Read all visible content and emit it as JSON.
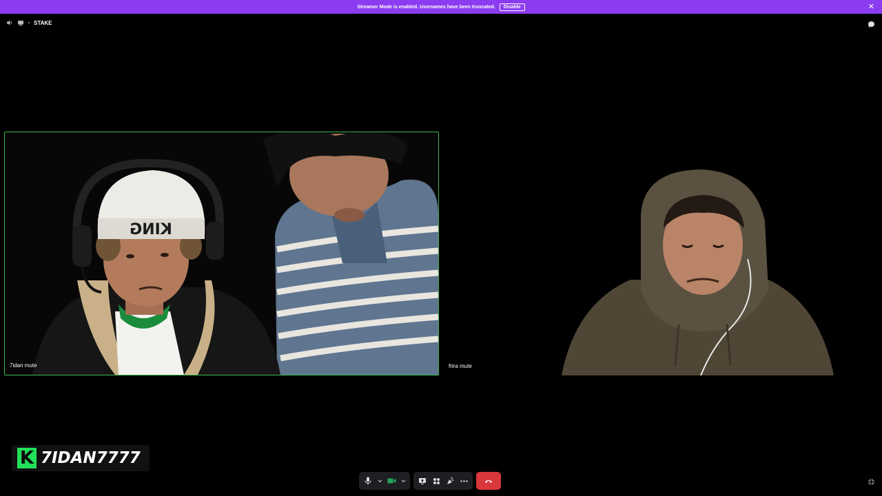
{
  "banner": {
    "text": "Streamer Mode is enabled. Usernames have been truncated.",
    "disable_label": "Disable",
    "close_glyph": "✕",
    "color": "#8b3cf0"
  },
  "topbar": {
    "channel_name": "STAKE",
    "icons": [
      "volume-icon",
      "channel-icon"
    ]
  },
  "tiles": [
    {
      "username": "7idan mute",
      "speaking": true,
      "border_color": "#3fb950"
    },
    {
      "username": "frira mute",
      "speaking": false
    }
  ],
  "brand": {
    "logo_letter": "K",
    "name": "7IDAN7777",
    "logo_color": "#22e05a"
  },
  "controls": {
    "items": [
      "microphone-icon",
      "camera-icon",
      "screen-share-icon",
      "activities-icon",
      "soundboard-icon",
      "more-icon",
      "end-call-icon"
    ],
    "end_call_color": "#da373c",
    "camera_color": "#23a55a"
  }
}
